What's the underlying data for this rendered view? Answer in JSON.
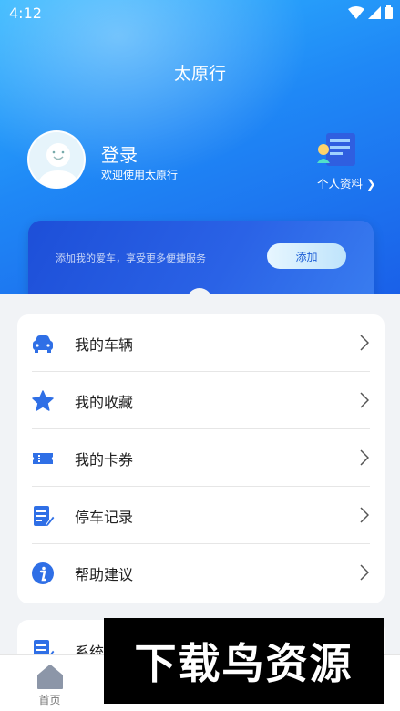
{
  "status_bar": {
    "time": "4:12"
  },
  "app": {
    "title": "太原行"
  },
  "user": {
    "login_label": "登录",
    "welcome": "欢迎使用太原行"
  },
  "profile": {
    "label": "个人资料 ❯"
  },
  "car_card": {
    "hint": "添加我的爱车，享受更多便捷服务",
    "add_button": "添加"
  },
  "menu": {
    "items": [
      {
        "label": "我的车辆",
        "icon": "car-icon"
      },
      {
        "label": "我的收藏",
        "icon": "star-icon"
      },
      {
        "label": "我的卡券",
        "icon": "ticket-icon"
      },
      {
        "label": "停车记录",
        "icon": "document-edit-icon"
      },
      {
        "label": "帮助建议",
        "icon": "info-icon"
      }
    ]
  },
  "second_menu": {
    "label": "系统",
    "icon": "settings-document-icon"
  },
  "tabbar": {
    "tabs": [
      {
        "label": "首页",
        "icon": "home-icon"
      }
    ]
  },
  "watermark": {
    "text": "下载鸟资源"
  },
  "colors": {
    "accent": "#1a6ff0",
    "header_top": "#2fb6ff",
    "header_bottom": "#1a5fe8"
  }
}
